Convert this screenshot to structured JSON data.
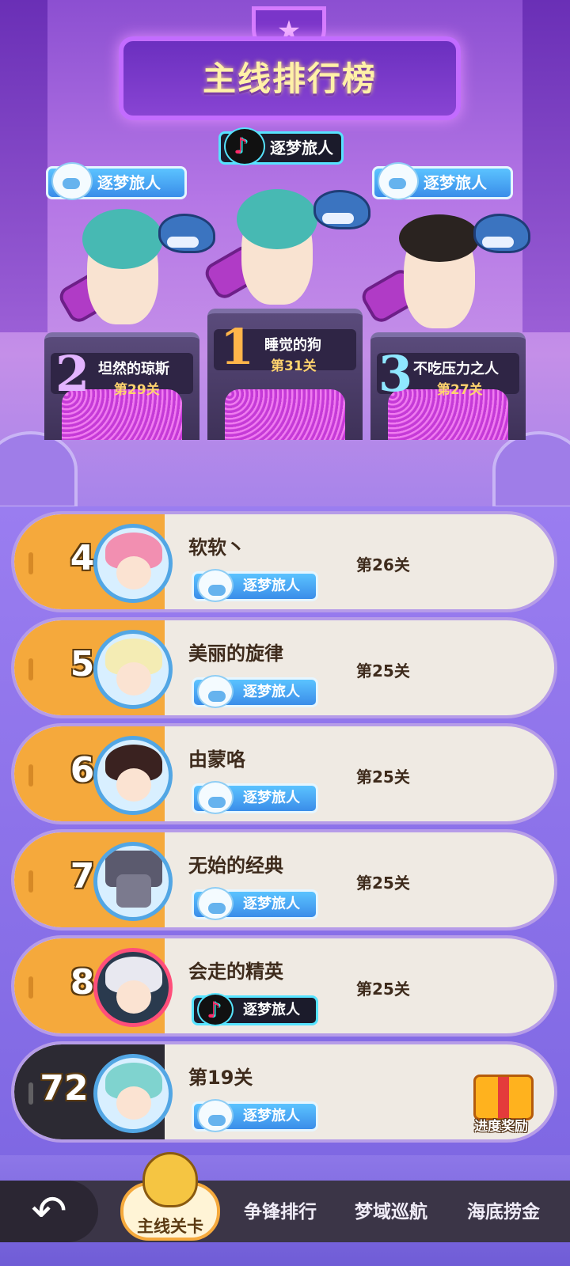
{
  "header": {
    "title": "主线排行榜"
  },
  "top3": [
    {
      "rank": "1",
      "name": "睡觉的狗",
      "level": "第31关",
      "tag": "逐梦旅人",
      "tag_style": "tiktok",
      "rank_color": "#ffb54a"
    },
    {
      "rank": "2",
      "name": "坦然的琼斯",
      "level": "第29关",
      "tag": "逐梦旅人",
      "tag_style": "dream",
      "rank_color": "#e3b4ff"
    },
    {
      "rank": "3",
      "name": "不吃压力之人",
      "level": "第27关",
      "tag": "逐梦旅人",
      "tag_style": "dream",
      "rank_color": "#8fe7ff"
    }
  ],
  "ranking": [
    {
      "rank": "4",
      "name": "软软丶",
      "level": "第26关",
      "tag": "逐梦旅人",
      "tag_style": "dream"
    },
    {
      "rank": "5",
      "name": "美丽的旋律",
      "level": "第25关",
      "tag": "逐梦旅人",
      "tag_style": "dream"
    },
    {
      "rank": "6",
      "name": "由蒙咯",
      "level": "第25关",
      "tag": "逐梦旅人",
      "tag_style": "dream"
    },
    {
      "rank": "7",
      "name": "无始的经典",
      "level": "第25关",
      "tag": "逐梦旅人",
      "tag_style": "dream"
    },
    {
      "rank": "8",
      "name": "会走的精英",
      "level": "第25关",
      "tag": "逐梦旅人",
      "tag_style": "tiktok"
    }
  ],
  "me": {
    "rank": "72",
    "level": "第19关",
    "tag": "逐梦旅人",
    "reward_label": "进度奖励"
  },
  "nav": {
    "back_icon": "back-arrow-icon",
    "tabs": [
      "主线关卡",
      "争锋排行",
      "梦域巡航",
      "海底捞金"
    ],
    "active": "主线关卡"
  },
  "colors": {
    "orange": "#f5a93c",
    "purple": "#8a6fe6",
    "dark": "#2c2a33"
  }
}
